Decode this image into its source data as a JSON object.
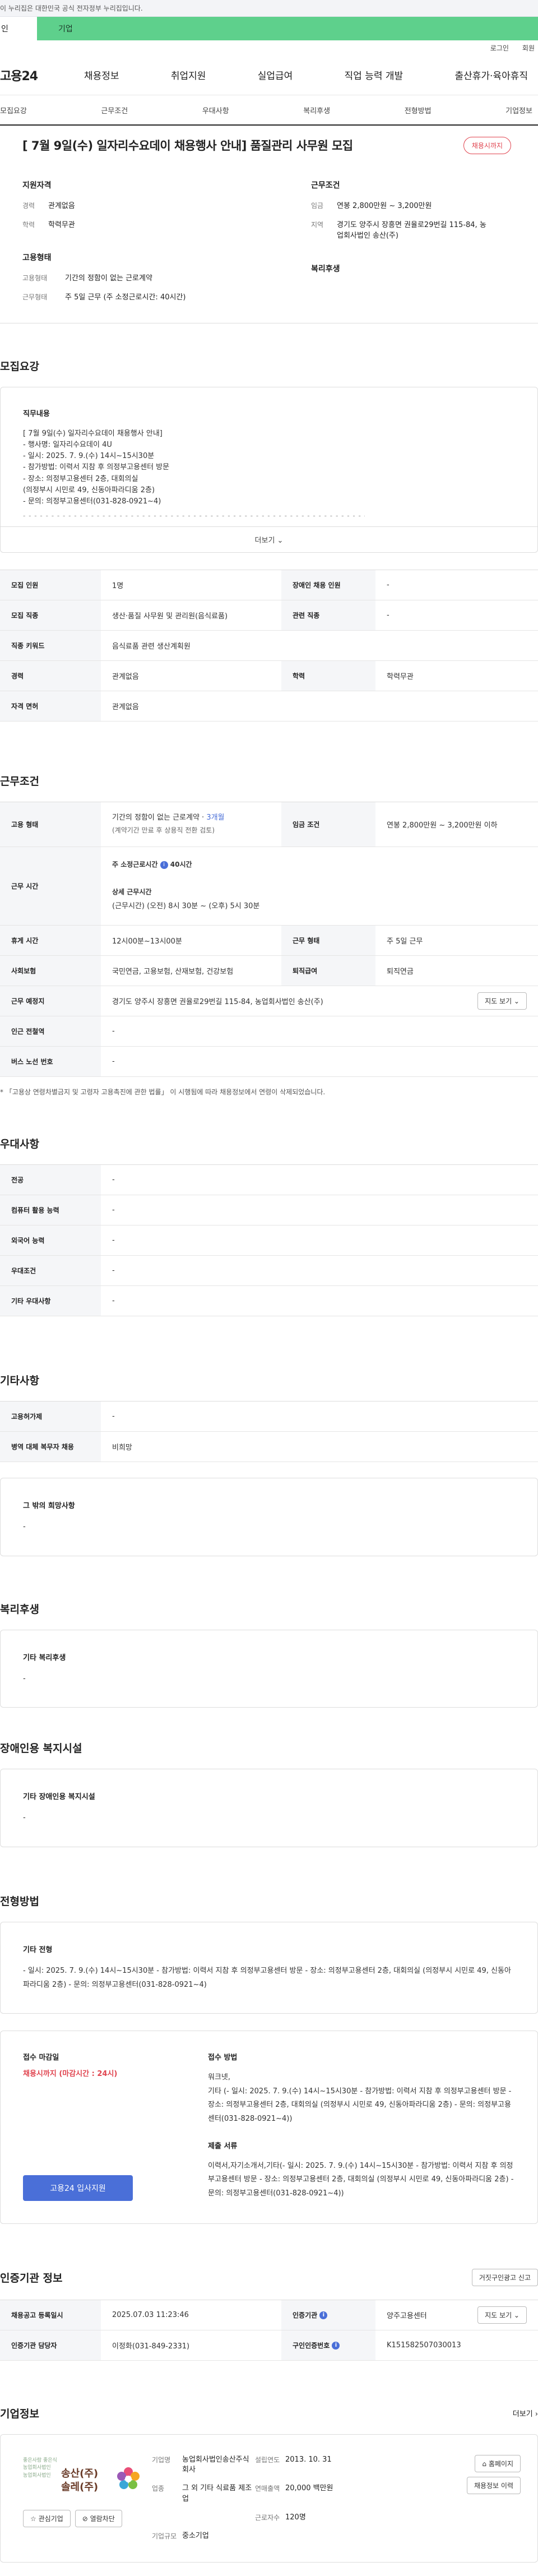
{
  "gov_banner": "이 누리집은 대한민국 공식 전자정부 누리집입니다.",
  "tabs": [
    "인",
    "기업"
  ],
  "util_links": [
    "로그인",
    "회원"
  ],
  "logo": "고용24",
  "gnb": [
    "채용정보",
    "취업지원",
    "실업급여",
    "직업 능력 개발",
    "출산휴가·육아휴직"
  ],
  "lnb": [
    "모집요강",
    "근무조건",
    "우대사항",
    "복리후생",
    "전형방법",
    "기업정보"
  ],
  "top": {
    "title": "[ 7월 9일(수) 일자리수요데이 채용행사 안내] 품질관리 사무원 모집",
    "pill": "채용시까지",
    "qual_title": "지원자격",
    "qual": [
      {
        "k": "경력",
        "v": "관계없음"
      },
      {
        "k": "학력",
        "v": "학력무관"
      }
    ],
    "cond_title": "근무조건",
    "cond": [
      {
        "k": "임금",
        "v": "연봉 2,800만원 ~ 3,200만원"
      },
      {
        "k": "지역",
        "v": "경기도 양주시 장흥면 권율로29번길 115-84, 농업회사법인 송산(주)"
      }
    ],
    "emp_title": "고용형태",
    "emp": [
      {
        "k": "고용형태",
        "v": "기간의 정함이 없는 근로계약"
      },
      {
        "k": "근무형태",
        "v": "주 5일 근무 (주 소정근로시간: 40시간)"
      }
    ],
    "welfare_title": "복리후생"
  },
  "recruit": {
    "heading": "모집요강",
    "duty_label": "직무내용",
    "duty_text": "[ 7월 9일(수) 일자리수요데이 채용행사 안내]\n- 행사명: 일자리수요데이 4U\n- 일시: 2025. 7. 9.(수) 14시~15시30분\n- 참가방법: 이력서 지참 후 의정부고용센터 방문\n- 장소: 의정부고용센터 2층, 대회의실\n(의정부시 시민로 49, 신동아파라디움 2층)\n- 문의: 의정부고용센터(031-828-0921~4)",
    "dashes": "- - - - - - - - - - - - - - - - - - - - - - - - - - - - - - - - - - - - - - - - - - - - - - - - - - - - - - - - - - - - -",
    "more": "더보기 ⌄",
    "rows": [
      [
        "모집 인원",
        "1명",
        "장애인 채용 인원",
        "-"
      ],
      [
        "모집 직종",
        "생산·품질 사무원 및 관리원(음식료품)",
        "관련 직종",
        "-"
      ],
      [
        "직종 키워드",
        "음식료품 관련 생산계획원"
      ],
      [
        "경력",
        "관계없음",
        "학력",
        "학력무관"
      ],
      [
        "자격 면허",
        "관계없음"
      ]
    ]
  },
  "work": {
    "heading": "근무조건",
    "emp_k": "고용 형태",
    "emp_v1": "기간의 정함이 없는 근로계약 · ",
    "emp_v1b": "3개월",
    "emp_v2": "(계약기간 만료 후 상용직 전환 검토)",
    "wage_k": "임금 조건",
    "wage_v": "연봉 2,800만원 ~ 3,200만원 이하",
    "time_k": "근무 시간",
    "time_a": "주 소정근로시간",
    "time_a2": "40시간",
    "time_b": "상세 근무시간",
    "time_c": "(근무시간) (오전) 8시 30분 ~ (오후) 5시 30분",
    "rows": [
      [
        "휴게 시간",
        "12시00분~13시00분",
        "근무 형태",
        "주 5일 근무"
      ],
      [
        "사회보험",
        "국민연금, 고용보험, 산재보험, 건강보험",
        "퇴직급여",
        "퇴직연금"
      ]
    ],
    "place_k": "근무 예정지",
    "place_v": "경기도 양주시 장흥면 권율로29번길 115-84, 농업회사법인 송산(주)",
    "map_btn": "지도 보기 ⌄",
    "station_k": "인근 전철역",
    "station_v": "-",
    "bus_k": "버스 노선 번호",
    "bus_v": "-",
    "note": "* 「고용상 연령차별금지 및 고령자 고용촉진에 관한 법률」 이 시행됨에 따라 채용정보에서 연령이 삭제되었습니다."
  },
  "pref": {
    "heading": "우대사항",
    "rows": [
      [
        "전공",
        "-"
      ],
      [
        "컴퓨터 활용 능력",
        "-"
      ],
      [
        "외국어 능력",
        "-"
      ],
      [
        "우대조건",
        "-"
      ],
      [
        "기타 우대사항",
        "-"
      ]
    ]
  },
  "etc": {
    "heading": "기타사항",
    "rows": [
      [
        "고용허가제",
        "-"
      ],
      [
        "병역 대체 복무자 채용",
        "비희망"
      ]
    ],
    "box_label": "그 밖의 희망사항",
    "box_val": "-"
  },
  "welfare": {
    "heading": "복리후생",
    "label": "기타 복리후생",
    "val": "-"
  },
  "disabled": {
    "heading": "장애인용 복지시설",
    "label": "기타 장애인용 복지시설",
    "val": "-"
  },
  "select": {
    "heading": "전형방법",
    "label": "기타 전형",
    "val": "- 일시: 2025. 7. 9.(수) 14시~15시30분 - 참가방법: 이력서 지참 후 의정부고용센터 방문 - 장소: 의정부고용센터 2층, 대회의실 (의정부시 시민로 49, 신동아파라디움 2층) - 문의: 의정부고용센터(031-828-0921~4)",
    "deadline_label": "접수 마감일",
    "deadline": "채용시까지 (마감시간 : 24시)",
    "apply_btn": "고용24 입사지원",
    "method_label": "접수 방법",
    "method": "워크넷,\n기타 (- 일시: 2025. 7. 9.(수) 14시~15시30분 - 참가방법: 이력서 지참 후 의정부고용센터 방문 - 장소: 의정부고용센터 2층, 대회의실 (의정부시 시민로 49, 신동아파라디움 2층) - 문의: 의정부고용센터(031-828-0921~4))",
    "docs_label": "제출 서류",
    "docs": "이력서,자기소개서,기타(- 일시: 2025. 7. 9.(수) 14시~15시30분 - 참가방법: 이력서 지참 후 의정부고용센터 방문 - 장소: 의정부고용센터 2층, 대회의실 (의정부시 시민로 49, 신동아파라디움 2층) - 문의: 의정부고용센터(031-828-0921~4))"
  },
  "cert": {
    "heading": "인증기관 정보",
    "btn": "거짓구인광고 신고",
    "r1": [
      "채용공고 등록일시",
      "2025.07.03 11:23:46",
      "인증기관",
      "양주고용센터"
    ],
    "map_btn": "지도 보기 ⌄",
    "r2": [
      "인증기관 담당자",
      "이정화(031-849-2331)",
      "구인인증번호",
      "K151582507030013"
    ]
  },
  "comp": {
    "heading": "기업정보",
    "more": "더보기 ›",
    "logo_small": "좋은사람 좋은식\n농업회사법인\n농업회사법인",
    "logo_big": "송산(주)\n솔레(주)",
    "like_btn": "☆ 관심기업",
    "block_btn": "⊘ 열람차단",
    "info": [
      [
        "기업명",
        "농업회사법인송산주식회사",
        "설립연도",
        "2013. 10. 31"
      ],
      [
        "업종",
        "그 외 기타 식료품 제조업",
        "연매출액",
        "20,000 백만원"
      ],
      [
        "",
        "",
        "근로자수",
        "120명"
      ],
      [
        "기업규모",
        "중소기업",
        "",
        ""
      ]
    ],
    "home_btn": "⌂ 홈페이지",
    "more_btn": "채용정보 이력"
  }
}
